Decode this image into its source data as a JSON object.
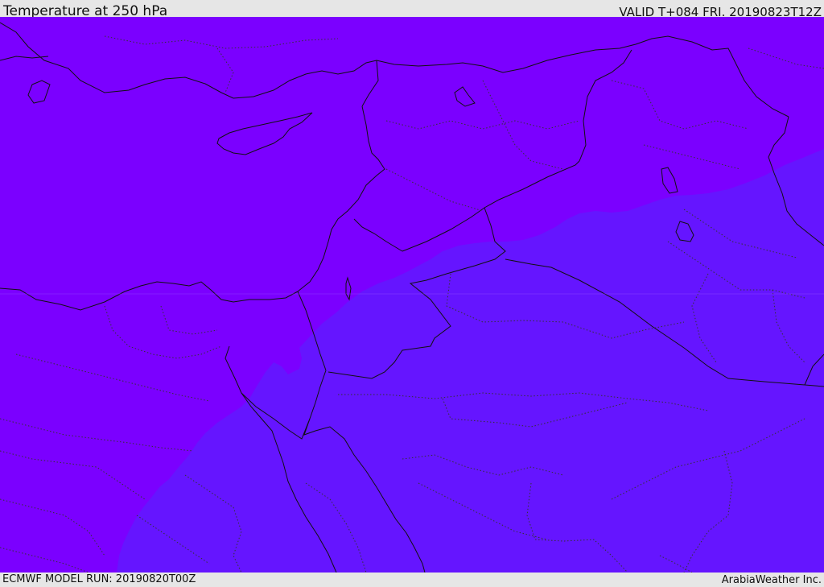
{
  "header": {
    "title": "Temperature at 250 hPa",
    "valid_time": "VALID T+084 FRI. 20190823T12Z"
  },
  "footer": {
    "model_run": "ECMWF MODEL RUN: 20190820T00Z",
    "credit": "ArabiaWeather Inc."
  },
  "map": {
    "colors": {
      "colder_fill": "#7b00ff",
      "warmer_fill": "#6515ff",
      "coastline": "#111111",
      "border": "#111111",
      "province_border": "#333333"
    }
  }
}
